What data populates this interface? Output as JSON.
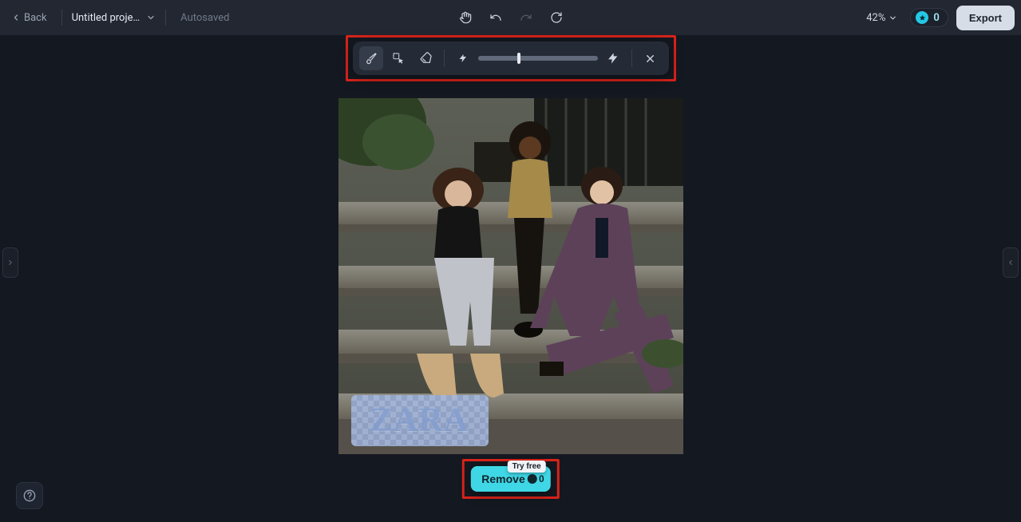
{
  "header": {
    "back_label": "Back",
    "project_name": "Untitled proje…",
    "autosaved_label": "Autosaved",
    "zoom_label": "42%",
    "credits_value": "0",
    "export_label": "Export"
  },
  "float_toolbar": {
    "brush_size_percent": 34
  },
  "canvas": {
    "mask_text": "ZARA"
  },
  "remove_button": {
    "label": "Remove",
    "badge": "Try free",
    "cost": "0"
  }
}
